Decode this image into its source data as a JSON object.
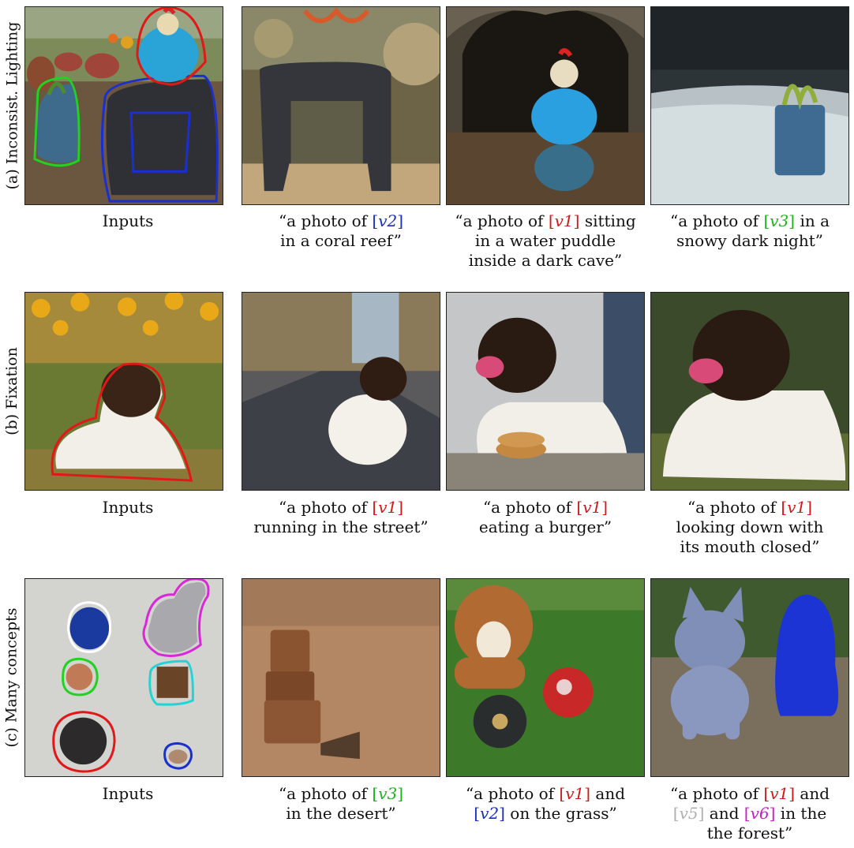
{
  "rows": [
    {
      "label": "(a) Inconsist. Lighting",
      "inputs_caption": "Inputs",
      "captions": [
        {
          "pre": "“a photo of ",
          "tok": "v2",
          "color": "blue",
          "post": "",
          "line2": "in a coral reef”",
          "line3": ""
        },
        {
          "pre": "“a photo of ",
          "tok": "v1",
          "color": "red",
          "post": " sitting",
          "line2": "in a water puddle",
          "line3": "inside a dark cave”"
        },
        {
          "pre": "“a photo of ",
          "tok": "v3",
          "color": "green",
          "post": " in a",
          "line2": "snowy dark night”",
          "line3": ""
        }
      ]
    },
    {
      "label": "(b) Fixation",
      "inputs_caption": "Inputs",
      "captions": [
        {
          "pre": "“a photo of ",
          "tok": "v1",
          "color": "red",
          "post": "",
          "line2": "running in the street”",
          "line3": ""
        },
        {
          "pre": "“a photo of ",
          "tok": "v1",
          "color": "red",
          "post": "",
          "line2": "eating a burger”",
          "line3": ""
        },
        {
          "pre": "“a photo of ",
          "tok": "v1",
          "color": "red",
          "post": "",
          "line2": "looking down with",
          "line3": "its mouth closed”"
        }
      ]
    },
    {
      "label": "(c) Many concepts",
      "inputs_caption": "Inputs",
      "captions": [
        {
          "pre": "“a photo of ",
          "tok": "v3",
          "color": "green",
          "post": "",
          "line2": "in the desert”",
          "line3": ""
        },
        {
          "pre": "“a photo of ",
          "tok": "v1",
          "color": "red",
          "post": " and",
          "line2_tok": "v2",
          "line2_color": "blue",
          "line2": " on the grass”",
          "line3": ""
        },
        {
          "pre": "“a photo of ",
          "tok": "v1",
          "color": "red",
          "post": " and",
          "line2_tok": "v5",
          "line2_color": "gray",
          "line2_mid_tok": "v6",
          "line2_mid_color": "mag",
          "line2": " in the",
          "line3": "the forest”"
        }
      ]
    }
  ],
  "colors": {
    "red": "#d01a1a",
    "blue": "#1a2fc0",
    "green": "#18b418",
    "gray": "#b0b0b0",
    "magenta": "#c81ec8",
    "cyan": "#22d3d3",
    "white": "#ffffff"
  }
}
